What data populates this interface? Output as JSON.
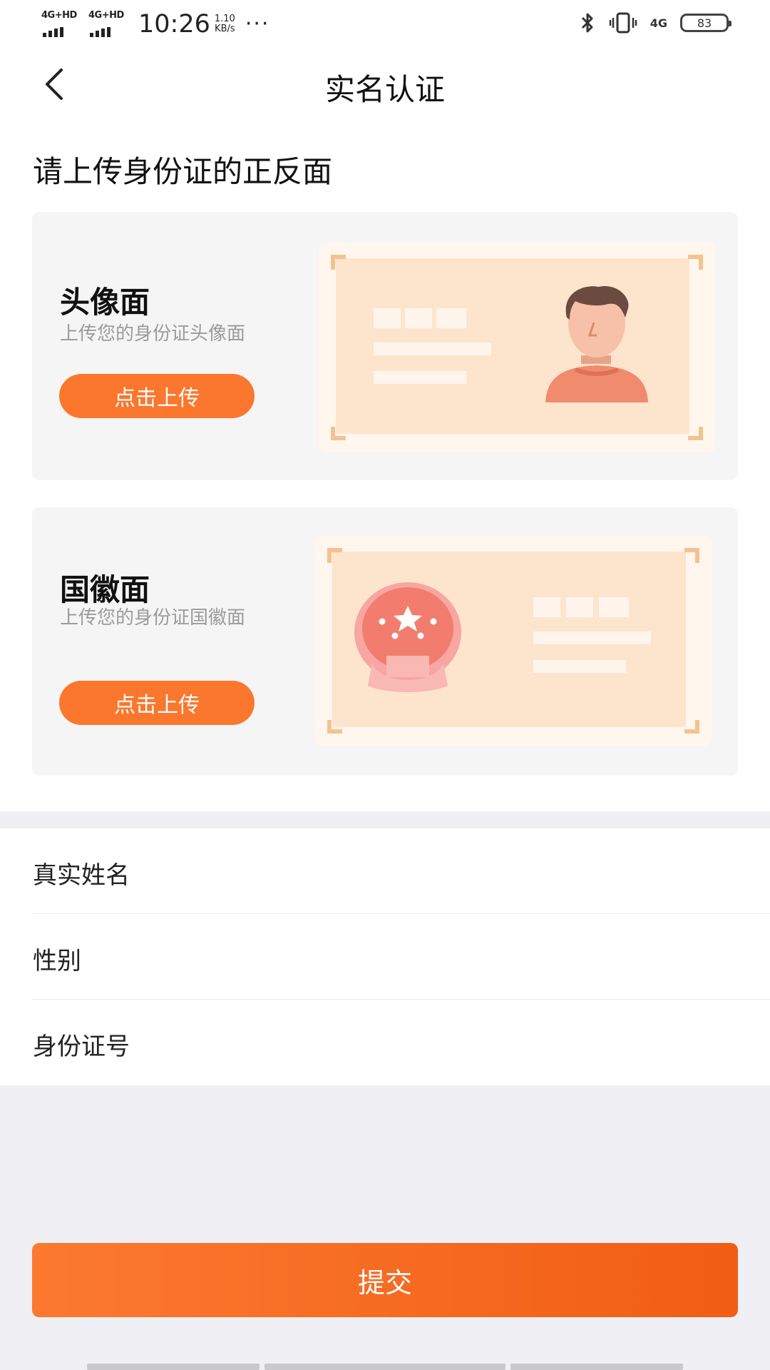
{
  "status_bar": {
    "sim1": "4G+HD",
    "sim2": "4G+HD",
    "time": "10:26",
    "speed_value": "1.10",
    "speed_unit": "KB/s",
    "more": "···",
    "network": "4G",
    "battery": "83"
  },
  "nav": {
    "title": "实名认证"
  },
  "upload": {
    "heading": "请上传身份证的正反面",
    "front": {
      "title": "头像面",
      "subtitle": "上传您的身份证头像面",
      "button": "点击上传"
    },
    "back": {
      "title": "国徽面",
      "subtitle": "上传您的身份证国徽面",
      "button": "点击上传"
    }
  },
  "form": {
    "name_label": "真实姓名",
    "gender_label": "性别",
    "id_label": "身份证号"
  },
  "submit": {
    "label": "提交"
  },
  "colors": {
    "accent": "#fb772d",
    "card_bg": "#f5f5f6",
    "id_card_fill": "#fde4cd"
  }
}
